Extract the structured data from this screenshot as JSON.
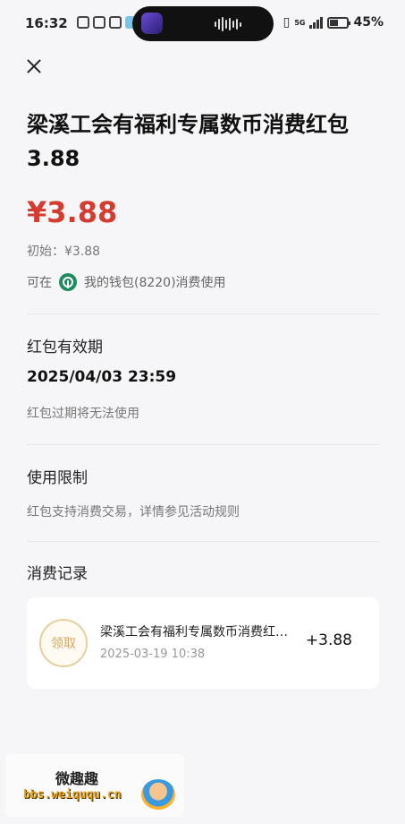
{
  "status_bar": {
    "time": "16:32",
    "network": "5G",
    "battery": "45%"
  },
  "header": {
    "title": "梁溪工会有福利专属数币消费红包3.88"
  },
  "amount": {
    "value": "¥3.88",
    "initial": "初始：¥3.88",
    "usable_prefix": "可在",
    "usable_wallet": "我的钱包(8220)消费使用"
  },
  "validity": {
    "title": "红包有效期",
    "expiry": "2025/04/03 23:59",
    "hint": "红包过期将无法使用"
  },
  "restriction": {
    "title": "使用限制",
    "text": "红包支持消费交易，详情参见活动规则"
  },
  "records": {
    "title": "消费记录",
    "items": [
      {
        "badge": "领取",
        "title": "梁溪工会有福利专属数币消费红包3.88",
        "time": "2025-03-19 10:38",
        "amount": "+3.88"
      }
    ]
  },
  "watermark": {
    "name": "微趣趣",
    "url": "bbs.weiququ.cn"
  },
  "colors": {
    "amount": "#d63b31",
    "badge": "#d2a55c",
    "wallet_icon": "#1f8b5f"
  }
}
